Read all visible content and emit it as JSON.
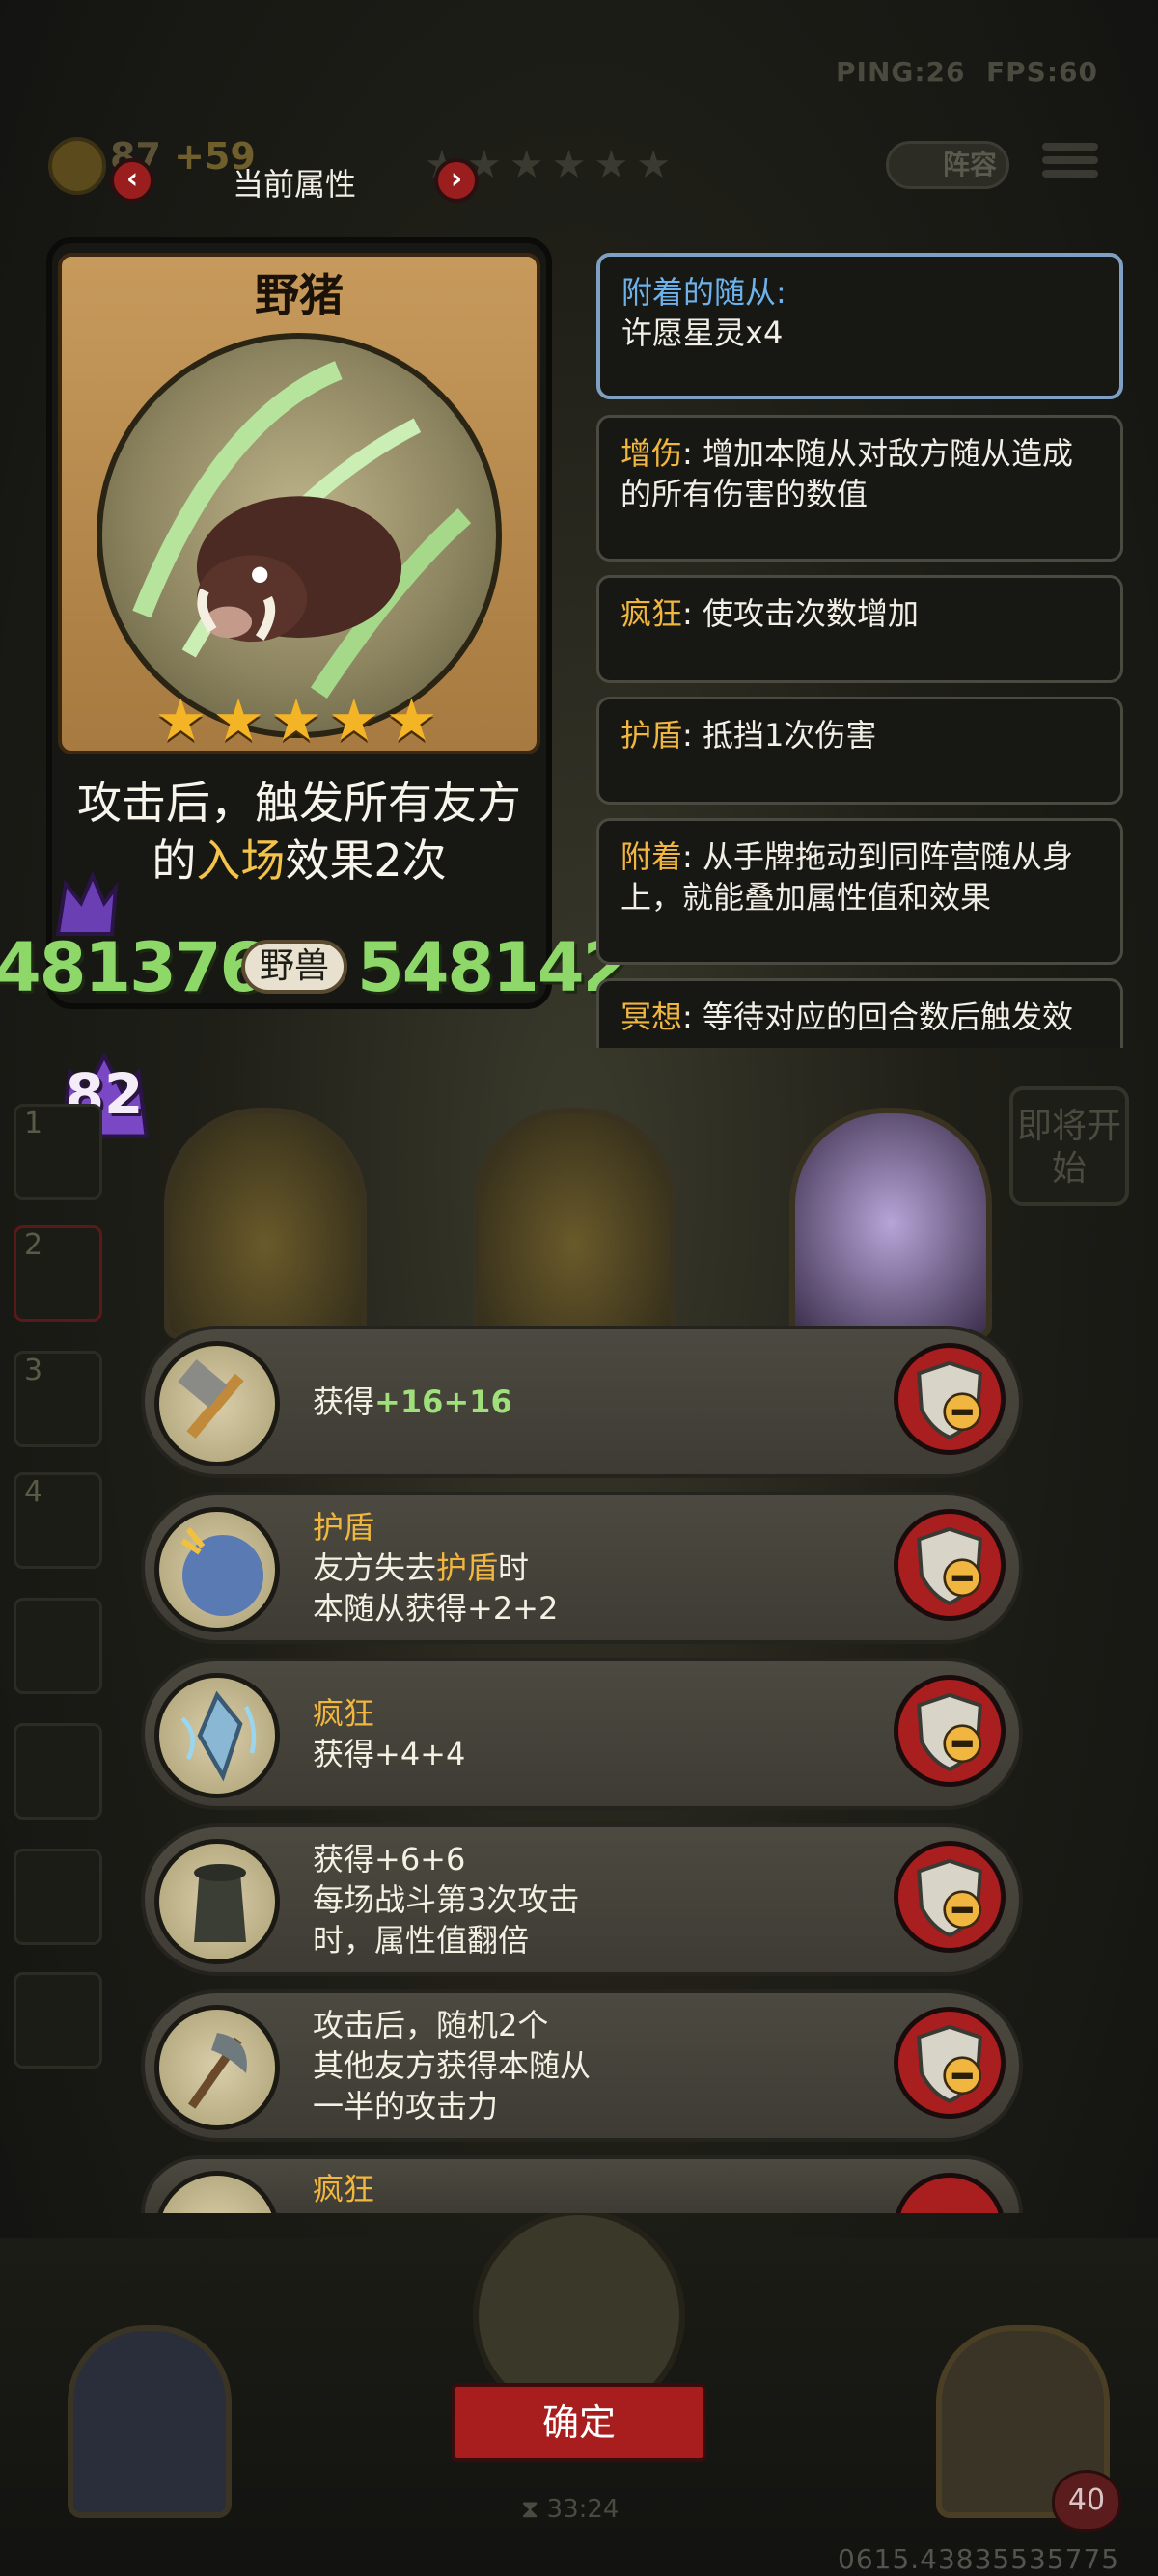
{
  "hud": {
    "ping": "PING:26",
    "fps": "FPS:60",
    "gold": "87",
    "gold_gain": "+59",
    "lineup_label": "阵容"
  },
  "attributes": {
    "title": "当前属性",
    "prev_glyph": "‹",
    "next_glyph": "›"
  },
  "minion": {
    "name": "野猪",
    "stars": 5,
    "stars_text": "★★★★★",
    "desc_prefix": "攻击后，触发所有友方的",
    "desc_keyword": "入场",
    "desc_suffix": "效果2次",
    "attack": "481376",
    "tribe": "野兽",
    "health": "548142"
  },
  "keyword_panels": [
    {
      "key": "附着的随从:",
      "text": "许愿星灵x4"
    },
    {
      "key": "增伤",
      "text": ": 增加本随从对敌方随从造成的所有伤害的数值"
    },
    {
      "key": "疯狂",
      "text": ": 使攻击次数增加"
    },
    {
      "key": "护盾",
      "text": ": 抵挡1次伤害"
    },
    {
      "key": "附着",
      "text": ": 从手牌拖动到同阵营随从身上，就能叠加属性值和效果"
    },
    {
      "key": "冥想",
      "text": ": 等待对应的回合数后触发效"
    }
  ],
  "board": {
    "level": "82",
    "start_button": "即将开始",
    "side_numbers": [
      "1",
      "2",
      "3",
      "4"
    ]
  },
  "enchants": [
    {
      "icon": "hammer-icon",
      "line1_prefix": "获得",
      "line1_values": "+16+16",
      "line2": "",
      "line3": ""
    },
    {
      "icon": "shield-orb-icon",
      "name": "护盾",
      "line2_prefix": "友方失去",
      "line2_kw": "护盾",
      "line2_suffix": "时",
      "line3": "本随从获得+2+2"
    },
    {
      "icon": "crystal-icon",
      "name": "疯狂",
      "line2": "获得+4+4"
    },
    {
      "icon": "cloak-figure-icon",
      "line1": "获得+6+6",
      "line2": "每场战斗第3次攻击",
      "line3": "时，属性值翻倍"
    },
    {
      "icon": "axe-icon",
      "line1": "攻击后，随机2个",
      "line2": "其他友方获得本随从",
      "line3": "一半的攻击力"
    },
    {
      "icon": "claw-icon",
      "name": "疯狂"
    }
  ],
  "footer": {
    "confirm_label": "确定",
    "timer": "33:24",
    "version": "0615.43835535775",
    "life": "40"
  }
}
